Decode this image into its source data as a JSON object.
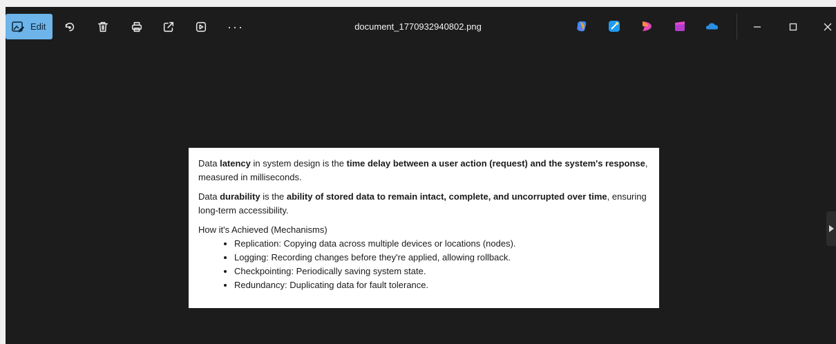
{
  "toolbar": {
    "edit_label": "Edit",
    "more_label": "···",
    "tools": [
      {
        "name": "rotate-icon"
      },
      {
        "name": "delete-icon"
      },
      {
        "name": "print-icon"
      },
      {
        "name": "share-icon"
      },
      {
        "name": "slideshow-icon"
      }
    ]
  },
  "window": {
    "title": "document_1770932940802.png",
    "apps": [
      "copilot-icon",
      "designer-icon",
      "clipchamp-icon",
      "video-editor-icon",
      "onedrive-icon"
    ],
    "controls": [
      "minimize-icon",
      "maximize-icon",
      "close-icon"
    ]
  },
  "document": {
    "p1": {
      "a": "Data ",
      "b": "latency",
      "c": " in system design is the ",
      "d": "time delay between a user action (request) and the system's response",
      "e": ", measured in milliseconds."
    },
    "p2": {
      "a": "Data ",
      "b": "durability",
      "c": " is the ",
      "d": "ability of stored data to remain intact, complete, and uncorrupted over time",
      "e": ", ensuring long-term accessibility."
    },
    "heading": "How it's Achieved (Mechanisms)",
    "bullets": [
      "Replication: Copying data across multiple devices or locations (nodes).",
      "Logging: Recording changes before they're applied, allowing rollback.",
      "Checkpointing: Periodically saving system state.",
      "Redundancy: Duplicating data for fault tolerance."
    ]
  },
  "colors": {
    "background": "#1c1c1c",
    "accent": "#6cb4ea",
    "frame": "#f0f0f0"
  }
}
